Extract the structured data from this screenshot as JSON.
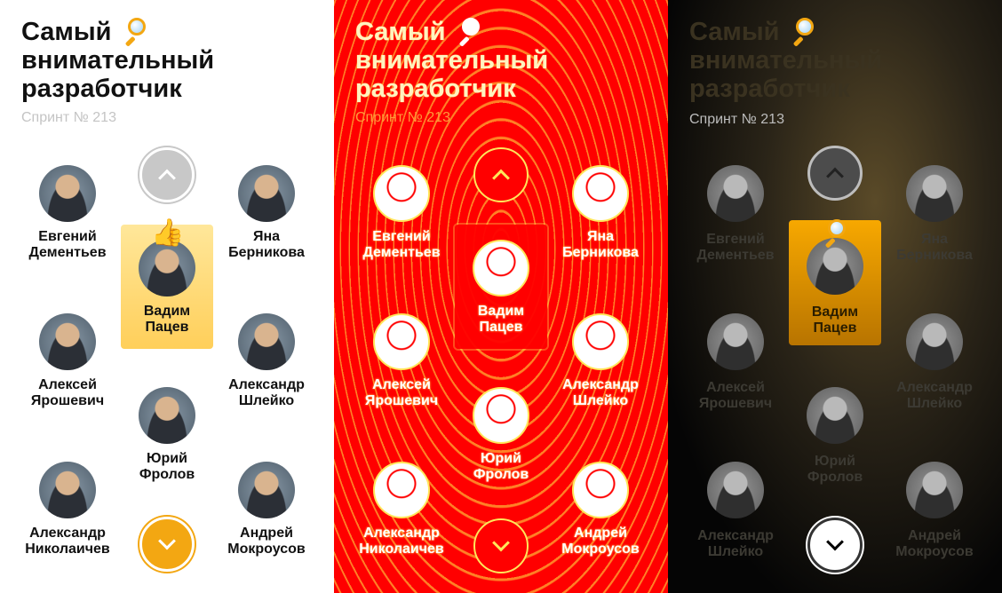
{
  "title_line1": "Самый",
  "title_line2": "внимательный",
  "title_line3": "разработчик",
  "sprint": "Спринт № 213",
  "thumb_emoji": "👍",
  "selected_person_index": 2,
  "people": [
    {
      "first": "Евгений",
      "last": "Дементьев"
    },
    {
      "first": "Яна",
      "last": "Берникова"
    },
    {
      "first": "Вадим",
      "last": "Пацев"
    },
    {
      "first": "Алексей",
      "last": "Ярошевич"
    },
    {
      "first": "Александр",
      "last": "Шлейко"
    },
    {
      "first": "Юрий",
      "last": "Фролов"
    },
    {
      "first": "Александр",
      "last": "Николаичев"
    },
    {
      "first": "Андрей",
      "last": "Мокроусов"
    }
  ],
  "people_dark_row3_left": {
    "first": "Александр",
    "last": "Шлейко"
  },
  "icons": {
    "title": "magnifier-icon",
    "up": "chevron-up-icon",
    "down": "chevron-down-icon",
    "reaction": "thumbs-up-icon"
  },
  "colors": {
    "accent": "#f3a712",
    "highlight": "#ffd86b",
    "red_theme": "#ff0000",
    "dark_theme": "#050505"
  }
}
